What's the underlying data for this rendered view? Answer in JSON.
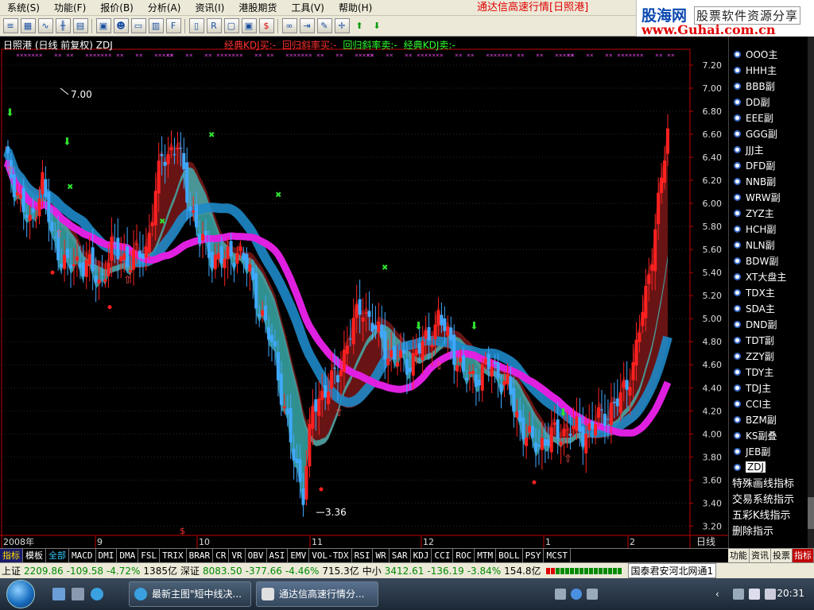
{
  "menu": [
    "系统(S)",
    "功能(F)",
    "报价(B)",
    "分析(A)",
    "资讯(I)",
    "港股期货",
    "工具(V)",
    "帮助(H)"
  ],
  "app_title": "通达信高速行情[日照港]",
  "logo": {
    "cn": "股海网",
    "sub": "股票软件资源分享",
    "url": "www.Guhai.com.cn"
  },
  "toolbar_icons": [
    "list-icon",
    "grid-icon",
    "chart-icon",
    "kline-icon",
    "table-icon",
    "folder-icon",
    "users-icon",
    "monitor-icon",
    "doc-icon",
    "f10-icon",
    "tape-icon",
    "rsi-icon",
    "screen-icon",
    "window-icon",
    "dollar-icon",
    "link-icon",
    "export-icon",
    "pen-icon",
    "cross-icon",
    "up-arrow-icon",
    "down-arrow-icon"
  ],
  "chart": {
    "title": "日照港 (日线 前复权) ZDJ",
    "indicators": [
      {
        "text": "经典KDJ买:-",
        "color": "#ff3030"
      },
      {
        "text": "回归斜率买:-",
        "color": "#ff3030"
      },
      {
        "text": "回归斜率卖:-",
        "color": "#30ff30"
      },
      {
        "text": "经典KDJ卖:-",
        "color": "#30ff30"
      }
    ],
    "high_label": "7.00",
    "low_label": "3.36",
    "period_label": "日线"
  },
  "chart_data": {
    "type": "candlestick",
    "title": "日照港 (日线 前复权) ZDJ",
    "y_ticks": [
      "7.20",
      "7.00",
      "6.80",
      "6.60",
      "6.40",
      "6.20",
      "6.00",
      "5.80",
      "5.60",
      "5.40",
      "5.20",
      "5.00",
      "4.80",
      "4.60",
      "4.40",
      "4.20",
      "4.00",
      "3.80",
      "3.60",
      "3.40",
      "3.20"
    ],
    "ylim": [
      3.12,
      7.31
    ],
    "x_labels": [
      "2008年",
      "9",
      "10",
      "11",
      "12",
      "1",
      "2"
    ],
    "max_price": 7.0,
    "min_price": 3.36,
    "close_path": [
      [
        0,
        6.4
      ],
      [
        4,
        6.1
      ],
      [
        8,
        5.8
      ],
      [
        12,
        6.2
      ],
      [
        15,
        5.7
      ],
      [
        20,
        5.45
      ],
      [
        26,
        5.5
      ],
      [
        30,
        5.3
      ],
      [
        34,
        5.6
      ],
      [
        40,
        5.5
      ],
      [
        45,
        5.6
      ],
      [
        50,
        6.4
      ],
      [
        55,
        6.5
      ],
      [
        58,
        6.1
      ],
      [
        62,
        5.7
      ],
      [
        66,
        5.55
      ],
      [
        70,
        5.5
      ],
      [
        74,
        5.6
      ],
      [
        78,
        5.4
      ],
      [
        82,
        5.0
      ],
      [
        86,
        4.7
      ],
      [
        89,
        4.2
      ],
      [
        92,
        3.8
      ],
      [
        95,
        3.5
      ],
      [
        98,
        4.2
      ],
      [
        102,
        4.4
      ],
      [
        106,
        4.5
      ],
      [
        110,
        4.9
      ],
      [
        114,
        5.1
      ],
      [
        118,
        4.9
      ],
      [
        122,
        4.7
      ],
      [
        128,
        4.6
      ],
      [
        134,
        4.8
      ],
      [
        138,
        5.0
      ],
      [
        142,
        4.8
      ],
      [
        146,
        4.5
      ],
      [
        150,
        4.5
      ],
      [
        155,
        4.6
      ],
      [
        160,
        4.4
      ],
      [
        164,
        4.1
      ],
      [
        168,
        3.9
      ],
      [
        172,
        3.95
      ],
      [
        176,
        4.0
      ],
      [
        180,
        4.05
      ],
      [
        184,
        4.0
      ],
      [
        188,
        4.1
      ],
      [
        192,
        4.2
      ],
      [
        196,
        4.3
      ],
      [
        200,
        4.6
      ],
      [
        204,
        5.2
      ],
      [
        208,
        6.0
      ],
      [
        211,
        6.6
      ]
    ],
    "overlay_bands": [
      {
        "name": "blue",
        "color": "#1e88c8"
      },
      {
        "name": "magenta",
        "color": "#e020e0"
      },
      {
        "name": "cyan",
        "color": "#40c0c0"
      },
      {
        "name": "maroon",
        "color": "#7a1818"
      }
    ]
  },
  "formula_list": [
    "OOO主",
    "HHH主",
    "BBB副",
    "DD副",
    "EEE副",
    "GGG副",
    "JJJ主",
    "DFD副",
    "NNB副",
    "WRW副",
    "ZYZ主",
    "HCH副",
    "NLN副",
    "BDW副",
    "XT大盘主",
    "TDX主",
    "SDA主",
    "DND副",
    "TDT副",
    "ZZY副",
    "TDY主",
    "TDJ主",
    "CCI主",
    "BZM副",
    "KS副叠",
    "JEB副",
    "ZDJ"
  ],
  "selected_formula": "ZDJ",
  "special_list": [
    "特殊画线指标",
    "交易系统指示",
    "五彩K线指示",
    "删除指示"
  ],
  "right_tabs": [
    "功能",
    "资讯",
    "投票",
    "指标"
  ],
  "indicator_tabs": [
    "指标",
    "模板",
    "全部",
    "MACD",
    "DMI",
    "DMA",
    "FSL",
    "TRIX",
    "BRAR",
    "CR",
    "VR",
    "OBV",
    "ASI",
    "EMV",
    "VOL-TDX",
    "RSI",
    "WR",
    "SAR",
    "KDJ",
    "CCI",
    "ROC",
    "MTM",
    "BOLL",
    "PSY",
    "MCST"
  ],
  "status": {
    "sh_label": "上证",
    "sh_value": "2209.86",
    "sh_change": "-109.58",
    "sh_pct": "-4.72%",
    "sh_amount": "1385亿",
    "sz_label": "深证",
    "sz_value": "8083.50",
    "sz_change": "-377.66",
    "sz_pct": "-4.46%",
    "sz_amount": "715.3亿",
    "zx_label": "中小",
    "zx_value": "3412.61",
    "zx_change": "-136.19",
    "zx_pct": "-3.84%",
    "zx_amount": "154.8亿",
    "broker": "国泰君安河北网通1"
  },
  "taskbar": {
    "tasks": [
      "最新主图\"短中线决...",
      "通达信高速行情分..."
    ],
    "clock": "20:31"
  }
}
